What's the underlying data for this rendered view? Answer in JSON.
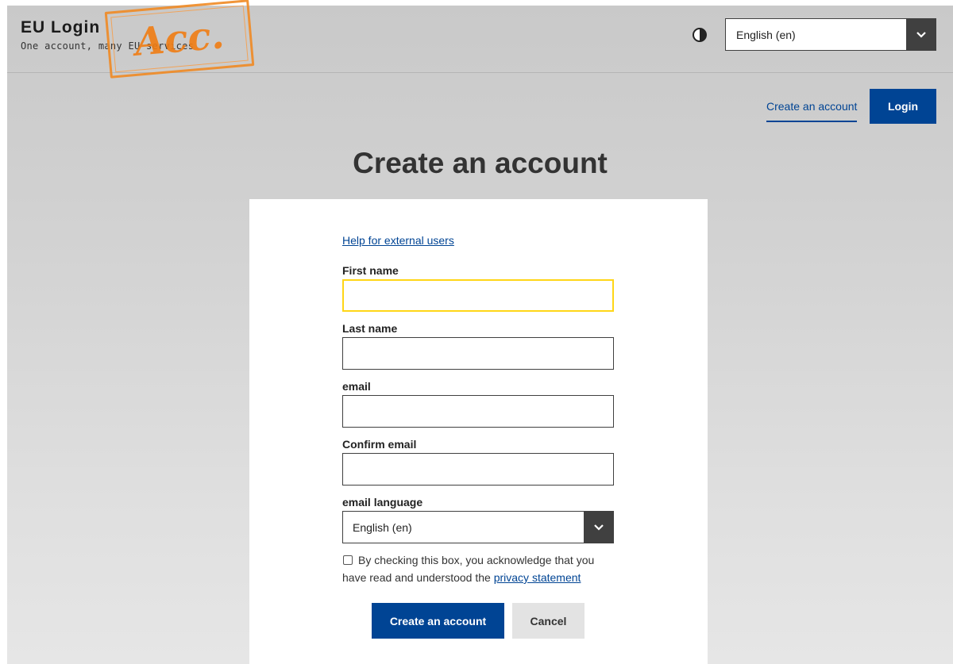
{
  "header": {
    "title": "EU Login",
    "subtitle": "One account, many EU services",
    "stamp_text": "Acc.",
    "language_select": {
      "value": "English (en)"
    }
  },
  "nav": {
    "create_account_link": "Create an account",
    "login_button": "Login"
  },
  "page": {
    "title": "Create an account"
  },
  "form": {
    "help_link": "Help for external users",
    "fields": [
      {
        "label": "First name",
        "value": ""
      },
      {
        "label": "Last name",
        "value": ""
      },
      {
        "label": "email",
        "value": ""
      },
      {
        "label": "Confirm email",
        "value": ""
      }
    ],
    "email_language": {
      "label": "email language",
      "value": "English (en)"
    },
    "consent": {
      "text": "By checking this box, you acknowledge that you have read and understood the",
      "link": "privacy statement",
      "checked": false
    },
    "submit_button": "Create an account",
    "cancel_button": "Cancel"
  },
  "colors": {
    "primary": "#004494",
    "focus": "#ffd617",
    "stamp": "#f07d14"
  }
}
